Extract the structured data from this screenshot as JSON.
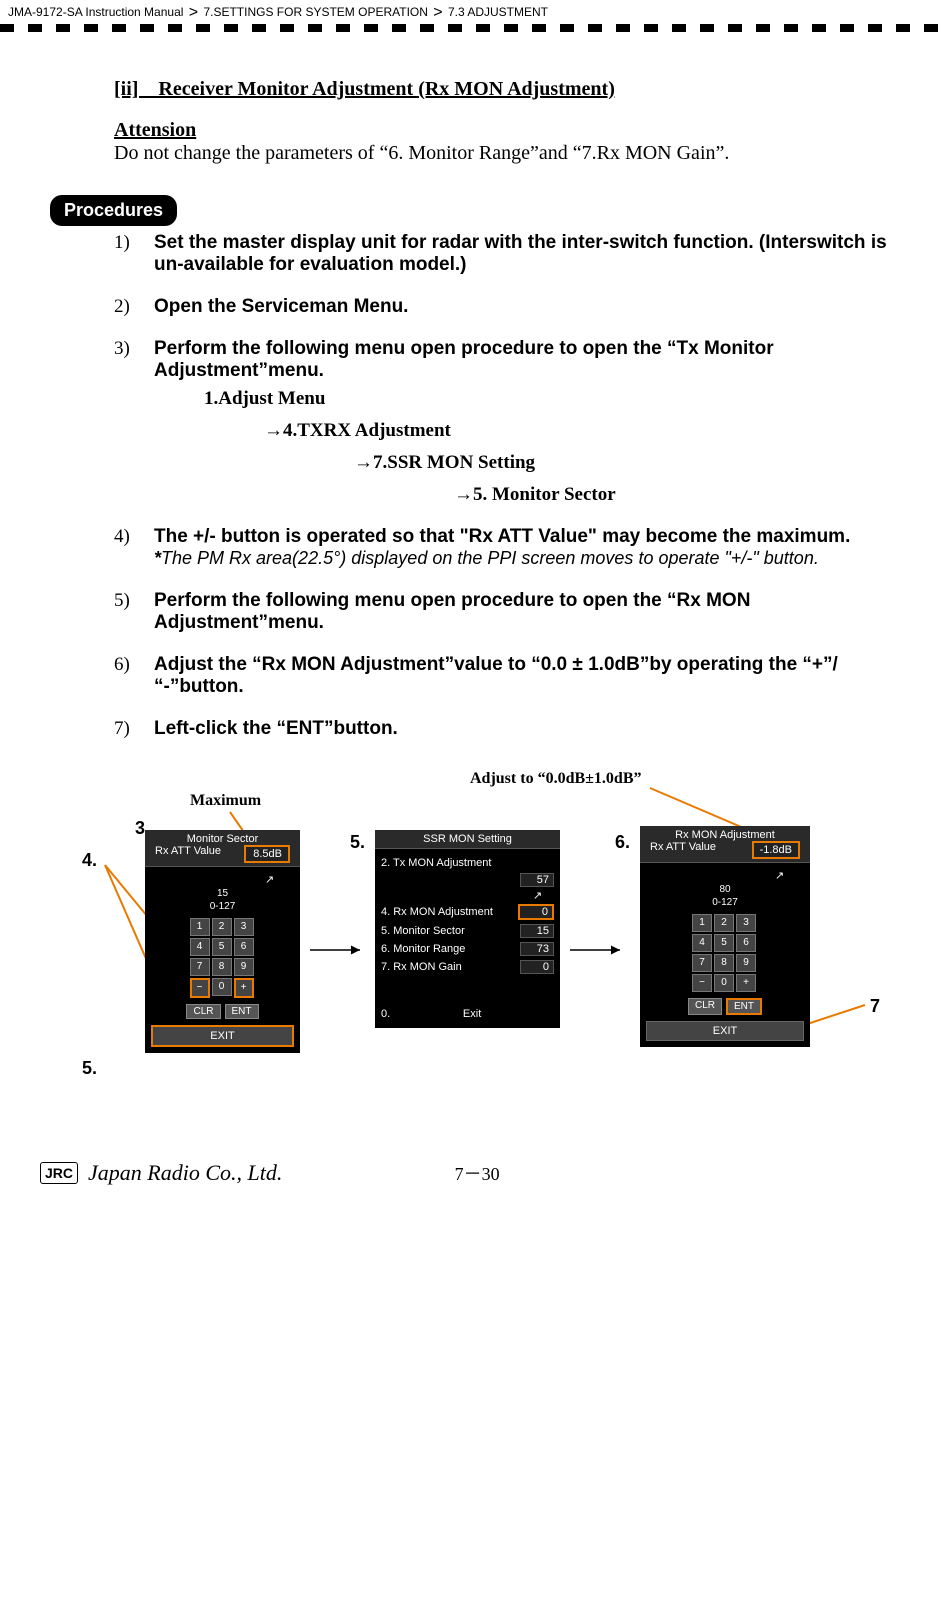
{
  "header": {
    "doc": "JMA-9172-SA Instruction Manual",
    "crumb1": "7.SETTINGS FOR SYSTEM OPERATION",
    "crumb2": "7.3  ADJUSTMENT"
  },
  "section": {
    "title": "[ii]　Receiver Monitor Adjustment (Rx MON Adjustment)",
    "attension_label": "Attension",
    "attension_body": "Do not change the parameters of “6. Monitor Range”and “7.Rx MON Gain”."
  },
  "procedures_label": "Procedures",
  "steps": {
    "s1": "Set the master display unit for radar with the inter-switch function. (Interswitch is un-available for evaluation model.)",
    "s2": "Open the Serviceman Menu.",
    "s3": "Perform the following menu open procedure to open the “Tx Monitor Adjustment”menu.",
    "menu": {
      "l1": "1.Adjust Menu",
      "l2": "→4.TXRX Adjustment",
      "l3": "→7.SSR MON Setting",
      "l4": "→5. Monitor Sector"
    },
    "s4a": "The +/- button is operated so that \"Rx ATT Value\" may become the maximum.",
    "s4b_star": "*",
    "s4b": "The PM Rx area(22.5°) displayed on the PPI screen moves to operate \"+/-\" button.",
    "s5": "Perform the following menu open procedure to open the “Rx MON Adjustment”menu.",
    "s6": "Adjust the “Rx MON Adjustment”value to “0.0 ± 1.0dB”by operating the  “+”/ “-”button.",
    "s7": "Left-click the “ENT”button."
  },
  "annotations": {
    "maximum": "Maximum",
    "adjust_to": "Adjust to “0.0dB±1.0dB”"
  },
  "callouts": {
    "c3": "3.",
    "c4": "4.",
    "c5a": "5.",
    "c5b": "5.",
    "c6": "6.",
    "c7": "7"
  },
  "panel1": {
    "title1": "Monitor Sector",
    "title2": "Rx ATT Value",
    "value": "8.5dB",
    "cur": "15",
    "range": "0-127",
    "keys": [
      "1",
      "2",
      "3",
      "4",
      "5",
      "6",
      "7",
      "8",
      "9",
      "−",
      "0",
      "+"
    ],
    "clr": "CLR",
    "ent": "ENT",
    "exit": "EXIT"
  },
  "panel2": {
    "title": "SSR MON Setting",
    "items": [
      {
        "label": "2. Tx MON Adjustment",
        "val": "57"
      },
      {
        "label": "4. Rx MON Adjustment",
        "val": "0"
      },
      {
        "label": "5. Monitor Sector",
        "val": "15"
      },
      {
        "label": "6. Monitor Range",
        "val": "73"
      },
      {
        "label": "7. Rx MON Gain",
        "val": "0"
      }
    ],
    "exit_l": "0.",
    "exit_r": "Exit"
  },
  "panel3": {
    "title1": "Rx MON Adjustment",
    "title2": "Rx ATT Value",
    "value": "-1.8dB",
    "cur": "80",
    "range": "0-127",
    "keys": [
      "1",
      "2",
      "3",
      "4",
      "5",
      "6",
      "7",
      "8",
      "9",
      "−",
      "0",
      "+"
    ],
    "clr": "CLR",
    "ent": "ENT",
    "exit": "EXIT"
  },
  "footer": {
    "jrc": "JRC",
    "company": "Japan Radio Co., Ltd.",
    "page": "7－30"
  }
}
